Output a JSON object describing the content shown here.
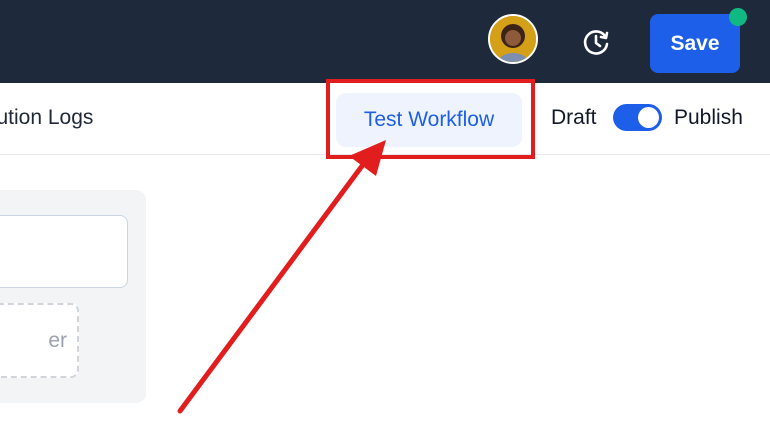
{
  "header": {
    "save_label": "Save",
    "avatar_icon": "user-avatar",
    "history_icon": "history-clock-icon",
    "status_color": "#10b981"
  },
  "toolbar": {
    "logs_tab_label": "cution Logs",
    "test_button_label": "Test Workflow",
    "draft_label": "Draft",
    "publish_label": "Publish",
    "publish_toggle_on": true
  },
  "panel": {
    "drop_zone_text": "er"
  },
  "annotation": {
    "color": "#e11d1d"
  }
}
